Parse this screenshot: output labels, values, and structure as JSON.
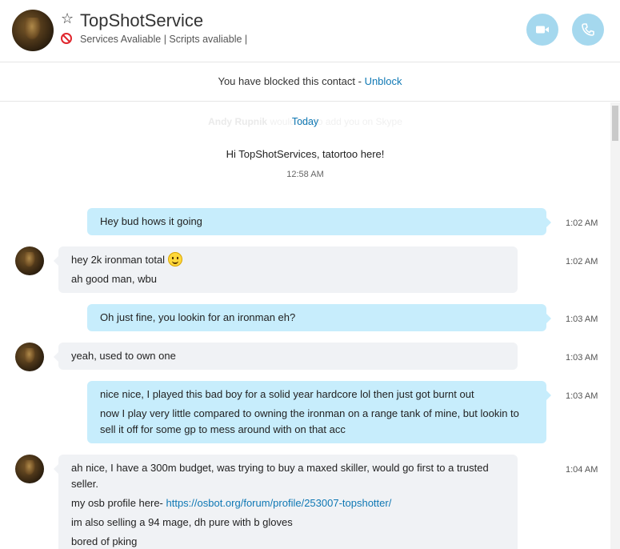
{
  "header": {
    "title": "TopShotService",
    "status": "Services Avaliable | Scripts avaliable |",
    "avatar_icon": "contact-avatar",
    "favorite_icon": "star-outline-icon",
    "blocked_icon": "blocked-icon",
    "video_icon": "video-camera-icon",
    "call_icon": "phone-icon"
  },
  "banner": {
    "text": "You have blocked this contact - ",
    "unblock_label": "Unblock"
  },
  "chat": {
    "faded_name": "Andy Rupnik",
    "faded_text": " would like to add you on Skype",
    "today_label": "Today",
    "system_message": "Hi TopShotServices, tatortoo here!",
    "system_time": "12:58 AM",
    "messages": [
      {
        "direction": "out",
        "time": "1:02 AM",
        "lines": [
          "Hey bud hows it going"
        ]
      },
      {
        "direction": "in",
        "time": "1:02 AM",
        "lines": [
          "hey 2k ironman total",
          "ah good man, wbu"
        ],
        "emoji": "smiley-icon"
      },
      {
        "direction": "out",
        "time": "1:03 AM",
        "lines": [
          "Oh just fine, you lookin for an ironman eh?"
        ]
      },
      {
        "direction": "in",
        "time": "1:03 AM",
        "lines": [
          "yeah, used to own one"
        ]
      },
      {
        "direction": "out",
        "time": "1:03 AM",
        "lines": [
          "nice nice, I played this bad boy for a solid year hardcore lol then just got burnt out",
          "now I play very little compared to owning the ironman on a range tank of mine, but lookin to sell it off for some gp to mess around with on that acc"
        ]
      },
      {
        "direction": "in",
        "time": "1:04 AM",
        "lines": [
          "ah nice, I have a 300m budget, was trying to buy a maxed skiller, would go first to a trusted seller.",
          "my osb profile here- ",
          "im also selling a 94 mage, dh pure with b gloves",
          "bored of pking"
        ],
        "link": "https://osbot.org/forum/profile/253007-topshotter/"
      }
    ]
  }
}
